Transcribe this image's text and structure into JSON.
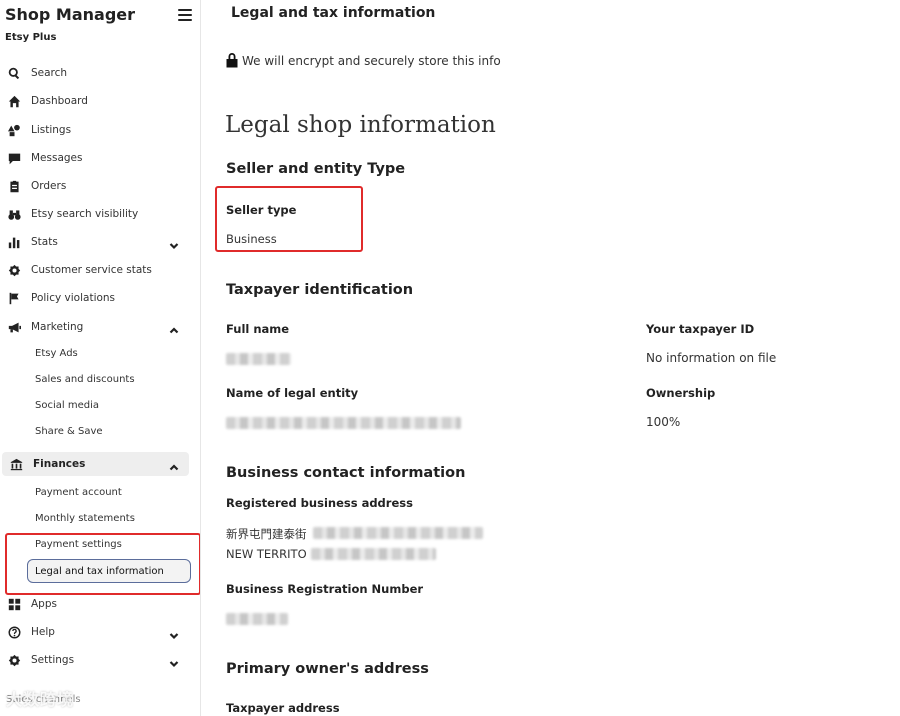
{
  "sidebar": {
    "title": "Shop Manager",
    "subtitle": "Etsy Plus",
    "items": [
      {
        "label": "Search",
        "icon": "search-icon"
      },
      {
        "label": "Dashboard",
        "icon": "home-icon"
      },
      {
        "label": "Listings",
        "icon": "shapes-icon"
      },
      {
        "label": "Messages",
        "icon": "chat-icon"
      },
      {
        "label": "Orders",
        "icon": "clipboard-icon"
      },
      {
        "label": "Etsy search visibility",
        "icon": "binoculars-icon"
      },
      {
        "label": "Stats",
        "icon": "bar-chart-icon"
      },
      {
        "label": "Customer service stats",
        "icon": "gear-badge-icon"
      },
      {
        "label": "Policy violations",
        "icon": "flag-icon"
      },
      {
        "label": "Marketing",
        "icon": "megaphone-icon"
      },
      {
        "label": "Finances",
        "icon": "bank-icon"
      },
      {
        "label": "Apps",
        "icon": "grid-icon"
      },
      {
        "label": "Help",
        "icon": "question-icon"
      },
      {
        "label": "Settings",
        "icon": "gear-icon"
      }
    ],
    "marketing_sub": [
      "Etsy Ads",
      "Sales and discounts",
      "Social media",
      "Share & Save"
    ],
    "finances_sub": [
      "Payment account",
      "Monthly statements",
      "Payment settings",
      "Legal and tax information"
    ],
    "bottom_text": "Sales channels",
    "watermark": "大数跨境"
  },
  "main": {
    "page_title": "Legal and tax information",
    "encrypt_note": "We will encrypt and securely store this info",
    "legal_heading": "Legal shop information",
    "seller_section": "Seller and entity Type",
    "seller_type_label": "Seller type",
    "seller_type_value": "Business",
    "taxpayer_section": "Taxpayer identification",
    "full_name_label": "Full name",
    "legal_entity_label": "Name of legal entity",
    "taxpayer_id_label": "Your taxpayer ID",
    "taxpayer_id_value": "No information on file",
    "ownership_label": "Ownership",
    "ownership_value": "100%",
    "contact_section": "Business contact information",
    "reg_address_label": "Registered business address",
    "address_line1": "新界屯門建泰街",
    "address_line2": "NEW TERRITO",
    "brn_label": "Business Registration Number",
    "owner_section": "Primary owner's address",
    "taxpayer_address_label": "Taxpayer address"
  },
  "colors": {
    "highlight": "#e02b2b",
    "current_border": "#5b6d9b"
  }
}
